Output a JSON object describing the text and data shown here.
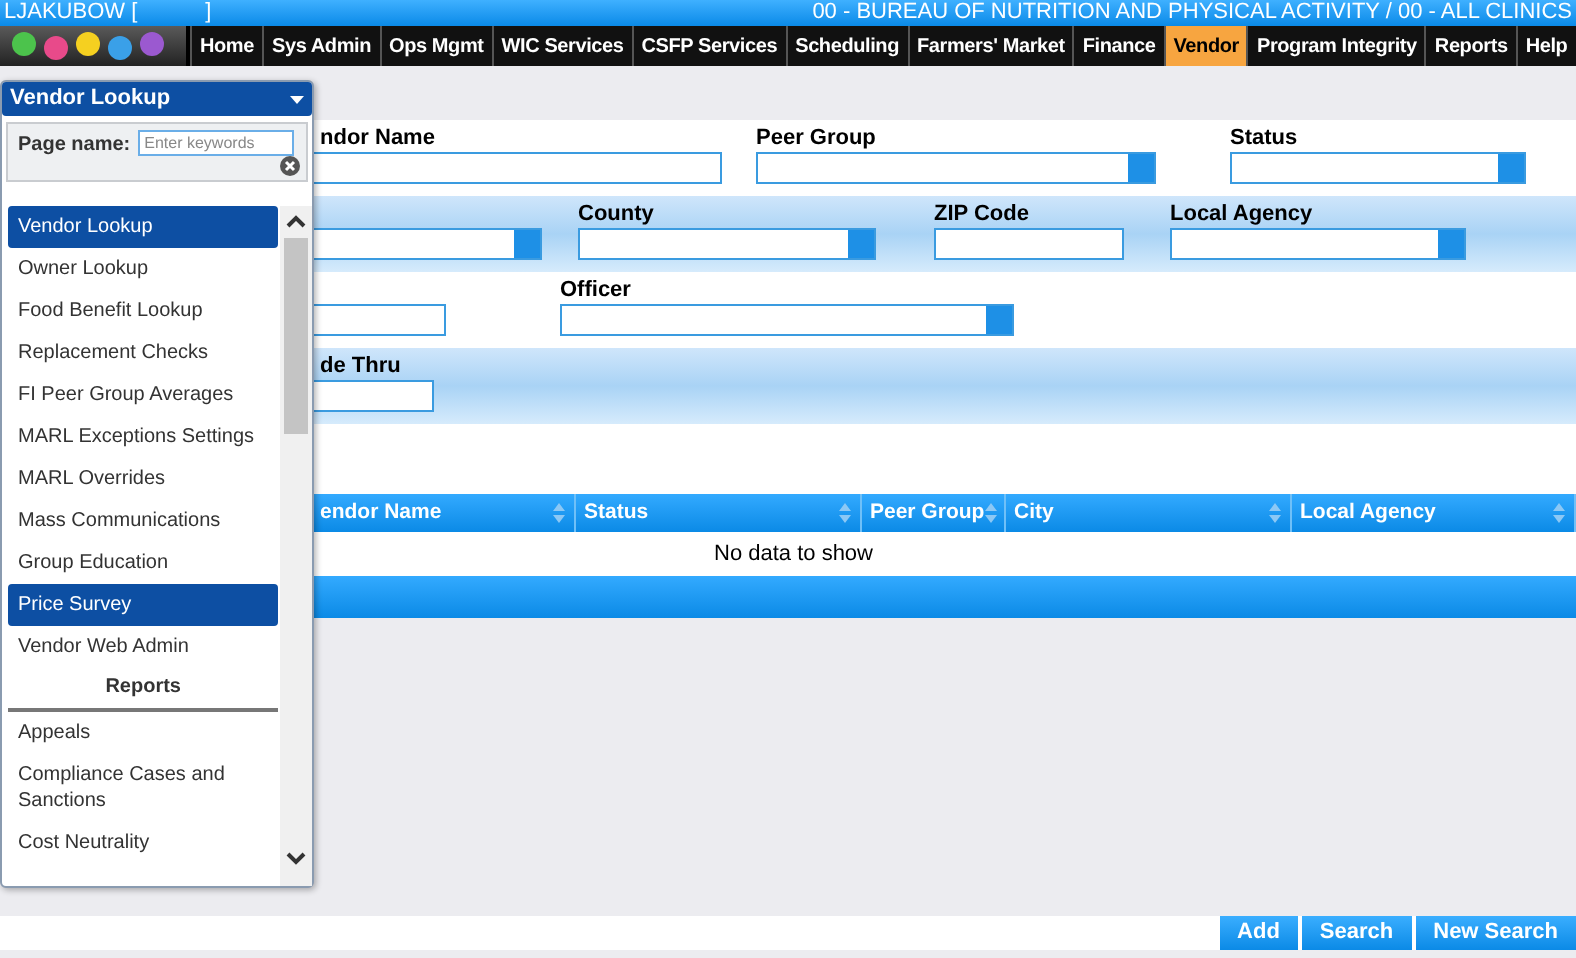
{
  "user": {
    "name": "LJAKUBOW [",
    "close": "]"
  },
  "org": "00 - BUREAU OF NUTRITION AND PHYSICAL ACTIVITY / 00 - ALL CLINICS",
  "nav": [
    {
      "label": "Home",
      "selected": false
    },
    {
      "label": "Sys Admin",
      "selected": false
    },
    {
      "label": "Ops Mgmt",
      "selected": false
    },
    {
      "label": "WIC Services",
      "selected": false
    },
    {
      "label": "CSFP Services",
      "selected": false
    },
    {
      "label": "Scheduling",
      "selected": false
    },
    {
      "label": "Farmers' Market",
      "selected": false
    },
    {
      "label": "Finance",
      "selected": false
    },
    {
      "label": "Vendor",
      "selected": true
    },
    {
      "label": "Program Integrity",
      "selected": false
    },
    {
      "label": "Reports",
      "selected": false
    },
    {
      "label": "Help",
      "selected": false
    }
  ],
  "form": {
    "rows": [
      {
        "shaded": false,
        "fields": [
          {
            "label": "ndor Name",
            "kind": "text"
          },
          {
            "label": "Peer Group",
            "kind": "select"
          },
          {
            "label": "Status",
            "kind": "select"
          }
        ]
      },
      {
        "shaded": true,
        "fields": [
          {
            "kind": "select"
          },
          {
            "label": "County",
            "kind": "select"
          },
          {
            "label": "ZIP Code",
            "kind": "text"
          },
          {
            "label": "Local Agency",
            "kind": "select"
          }
        ]
      },
      {
        "shaded": false,
        "fields": [
          {
            "kind": "text"
          },
          {
            "label": "Officer",
            "kind": "select"
          }
        ]
      },
      {
        "shaded": true,
        "fields": [
          {
            "label": "de Thru",
            "kind": "text"
          }
        ]
      }
    ]
  },
  "grid": {
    "columns": [
      "endor Name",
      "Status",
      "Peer Group",
      "City",
      "Local Agency"
    ],
    "empty_message": "No data to show"
  },
  "page_menu": {
    "title": "Vendor Lookup",
    "filter_label": "Page name:",
    "filter_placeholder": "Enter keywords",
    "items": [
      {
        "kind": "item",
        "label": "Vendor Lookup",
        "selected": true
      },
      {
        "kind": "item",
        "label": "Owner Lookup",
        "selected": false
      },
      {
        "kind": "item",
        "label": "Food Benefit Lookup",
        "selected": false
      },
      {
        "kind": "item",
        "label": "Replacement Checks",
        "selected": false
      },
      {
        "kind": "item",
        "label": "FI Peer Group Averages",
        "selected": false
      },
      {
        "kind": "item",
        "label": "MARL Exceptions Settings",
        "selected": false
      },
      {
        "kind": "item",
        "label": "MARL Overrides",
        "selected": false
      },
      {
        "kind": "item",
        "label": "Mass Communications",
        "selected": false
      },
      {
        "kind": "item",
        "label": "Group Education",
        "selected": false
      },
      {
        "kind": "item",
        "label": "Price Survey",
        "selected": true
      },
      {
        "kind": "item",
        "label": "Vendor Web Admin",
        "selected": false
      },
      {
        "kind": "heading",
        "label": "Reports"
      },
      {
        "kind": "item",
        "label": "Appeals",
        "selected": false
      },
      {
        "kind": "item",
        "label": "Compliance Cases and Sanctions",
        "selected": false
      },
      {
        "kind": "item",
        "label": "Cost Neutrality",
        "selected": false
      }
    ]
  },
  "buttons": [
    "Add",
    "Search",
    "New Search"
  ]
}
